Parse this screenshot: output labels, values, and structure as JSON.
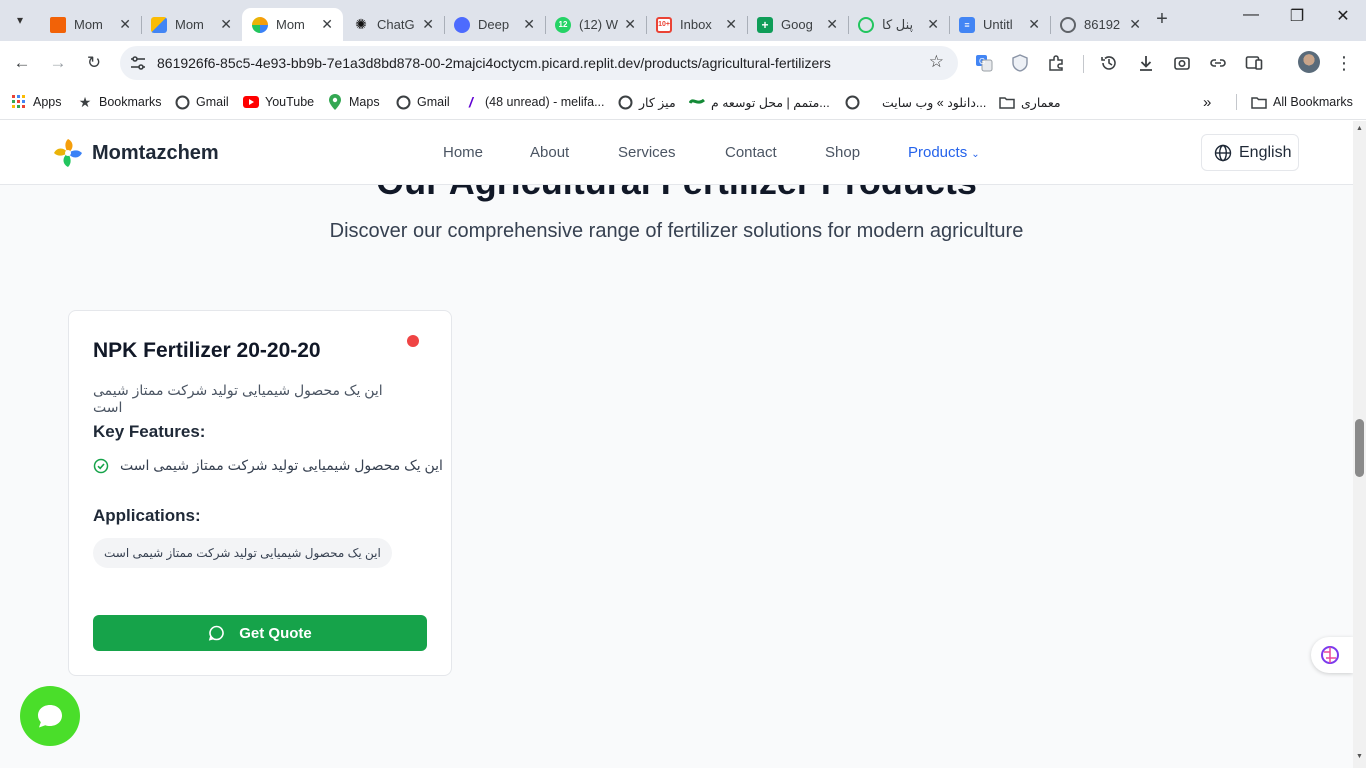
{
  "browser": {
    "tabs": [
      {
        "title": "Mom",
        "favicon": "replit-icon",
        "color": "#f26207"
      },
      {
        "title": "Mom",
        "favicon": "google-ads-icon",
        "color": "#fbbc04"
      },
      {
        "title": "Mom",
        "favicon": "momtazchem-logo-icon",
        "color": "#f59e0b",
        "active": true
      },
      {
        "title": "ChatG",
        "favicon": "chatgpt-icon",
        "color": "#111111"
      },
      {
        "title": "Deep",
        "favicon": "deepseek-icon",
        "color": "#4d6bfe"
      },
      {
        "title": "(12) W",
        "favicon": "whatsapp-icon",
        "color": "#25d366"
      },
      {
        "title": "Inbox",
        "favicon": "gmail-icon",
        "color": "#ea4335"
      },
      {
        "title": "Goog",
        "favicon": "google-sheets-icon",
        "color": "#0f9d58"
      },
      {
        "title": "پنل کا",
        "favicon": "panel-icon",
        "color": "#22c55e"
      },
      {
        "title": "Untitl",
        "favicon": "google-docs-icon",
        "color": "#4285f4"
      },
      {
        "title": "86192",
        "favicon": "globe-icon",
        "color": "#5f6368"
      }
    ],
    "url": "861926f6-85c5-4e93-bb9b-7e1a3d8bd878-00-2majci4octycm.picard.replit.dev/products/agricultural-fertilizers",
    "bookmarks": [
      {
        "label": "Apps",
        "icon": "apps-grid-icon"
      },
      {
        "label": "Bookmarks",
        "icon": "star-icon"
      },
      {
        "label": "Gmail",
        "icon": "globe-icon"
      },
      {
        "label": "YouTube",
        "icon": "youtube-icon"
      },
      {
        "label": "Maps",
        "icon": "maps-pin-icon"
      },
      {
        "label": "Gmail",
        "icon": "globe-icon"
      },
      {
        "label": "(48 unread) - melifa...",
        "icon": "yahoo-mail-icon"
      },
      {
        "label": "میز کار",
        "icon": "globe-icon"
      },
      {
        "label": "متمم | محل توسعه م...",
        "icon": "motamem-icon"
      },
      {
        "label": "دانلود » وب سایت...",
        "icon": "globe-icon"
      },
      {
        "label": "معماری",
        "icon": "folder-icon"
      }
    ],
    "all_bookmarks": "All Bookmarks"
  },
  "site": {
    "brand": "Momtazchem",
    "nav": [
      "Home",
      "About",
      "Services",
      "Contact",
      "Shop"
    ],
    "nav_active": "Products",
    "language": "English"
  },
  "hero": {
    "title": "Our Agricultural Fertilizer Products",
    "subtitle": "Discover our comprehensive range of fertilizer solutions for modern agriculture"
  },
  "product": {
    "name": "NPK Fertilizer 20-20-20",
    "status_color": "#ef4444",
    "description": "این یک محصول شیمیایی تولید شرکت ممتاز شیمی است",
    "features_heading": "Key Features:",
    "feature": "این یک محصول شیمیایی تولید شرکت ممتاز شیمی است",
    "applications_heading": "Applications:",
    "application": "این یک محصول شیمیایی تولید شرکت ممتاز شیمی است",
    "cta": "Get Quote",
    "cta_color": "#16a34a"
  }
}
